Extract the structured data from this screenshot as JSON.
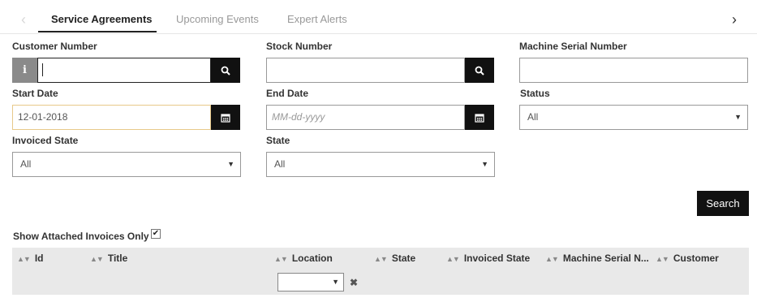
{
  "tabs": {
    "items": [
      {
        "label": "Service Agreements",
        "active": true
      },
      {
        "label": "Upcoming Events",
        "active": false
      },
      {
        "label": "Expert Alerts",
        "active": false
      }
    ],
    "prev_glyph": "‹",
    "next_glyph": "›"
  },
  "form": {
    "customer_number": {
      "label": "Customer Number",
      "value": "",
      "info_glyph": "i"
    },
    "stock_number": {
      "label": "Stock Number",
      "value": ""
    },
    "machine_serial_number": {
      "label": "Machine Serial Number",
      "value": ""
    },
    "start_date": {
      "label": "Start Date",
      "value": "12-01-2018"
    },
    "end_date": {
      "label": "End Date",
      "value": "",
      "placeholder": "MM-dd-yyyy"
    },
    "status": {
      "label": "Status",
      "selected": "All"
    },
    "invoiced_state": {
      "label": "Invoiced State",
      "selected": "All"
    },
    "state": {
      "label": "State",
      "selected": "All"
    },
    "search_button": "Search",
    "show_attached_label": "Show Attached Invoices Only",
    "show_attached_checked": true,
    "check_glyph": "✔"
  },
  "grid": {
    "columns": [
      "Id",
      "Title",
      "Location",
      "State",
      "Invoiced State",
      "Machine Serial N...",
      "Customer"
    ],
    "location_filter_value": "",
    "clear_glyph": "✖"
  },
  "colors": {
    "accent_dark": "#111111",
    "info_button": "#8a8a8a",
    "start_date_border": "#e8c98a",
    "grid_header_bg": "#e9e9e9"
  },
  "icons": {
    "search": "search-icon",
    "calendar": "calendar-icon",
    "info": "info-icon",
    "dropdown": "caret-down-icon",
    "sort": "sort-icon",
    "clear": "clear-filter-icon"
  }
}
